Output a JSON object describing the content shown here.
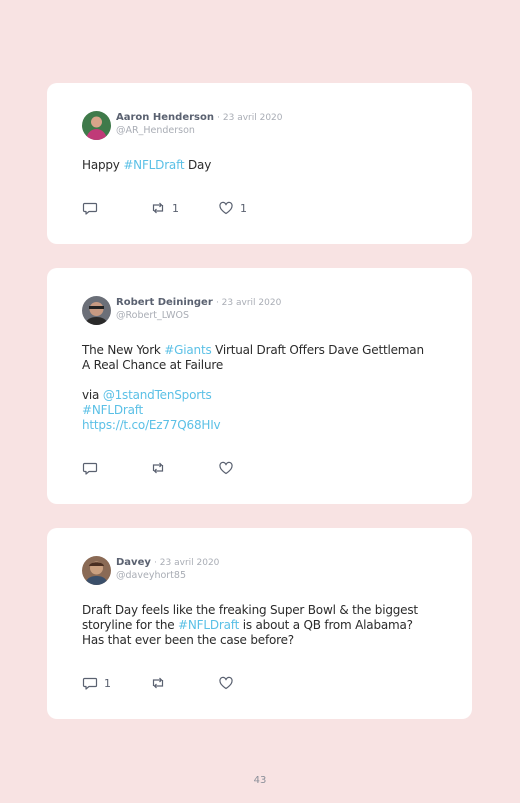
{
  "tweets": [
    {
      "name": "Aaron Henderson",
      "date": "· 23 avril 2020",
      "handle": "@AR_Henderson",
      "text_before": "Happy ",
      "hashtag": "#NFLDraft",
      "text_after": " Day",
      "retweets": "1",
      "likes": "1"
    },
    {
      "name": "Robert Deininger",
      "date": "· 23 avril 2020",
      "handle": "@Robert_LWOS",
      "line1_before": "The New York ",
      "line1_hashtag": "#Giants",
      "line1_after": " Virtual Draft Offers Dave Gettleman",
      "line2": "A Real Chance at Failure",
      "via_label": "via ",
      "via_mention": "@1standTenSports",
      "hashtag": "#NFLDraft",
      "url": "https://t.co/Ez77Q68HIv"
    },
    {
      "name": "Davey",
      "date": "· 23 avril 2020",
      "handle": "@daveyhort85",
      "line1": "Draft Day feels like the freaking Super Bowl & the biggest",
      "line2_before": "storyline for the ",
      "line2_hashtag": "#NFLDraft",
      "line2_after": " is about a QB from Alabama?",
      "line3": "Has that ever been the case before?",
      "replies": "1"
    }
  ],
  "page_number": "43",
  "colors": {
    "background": "#f8e3e3",
    "card": "#ffffff",
    "link": "#5bc0e6",
    "name": "#5a6170",
    "muted": "#a9adb5"
  },
  "icons": [
    "reply-icon",
    "retweet-icon",
    "like-icon"
  ]
}
